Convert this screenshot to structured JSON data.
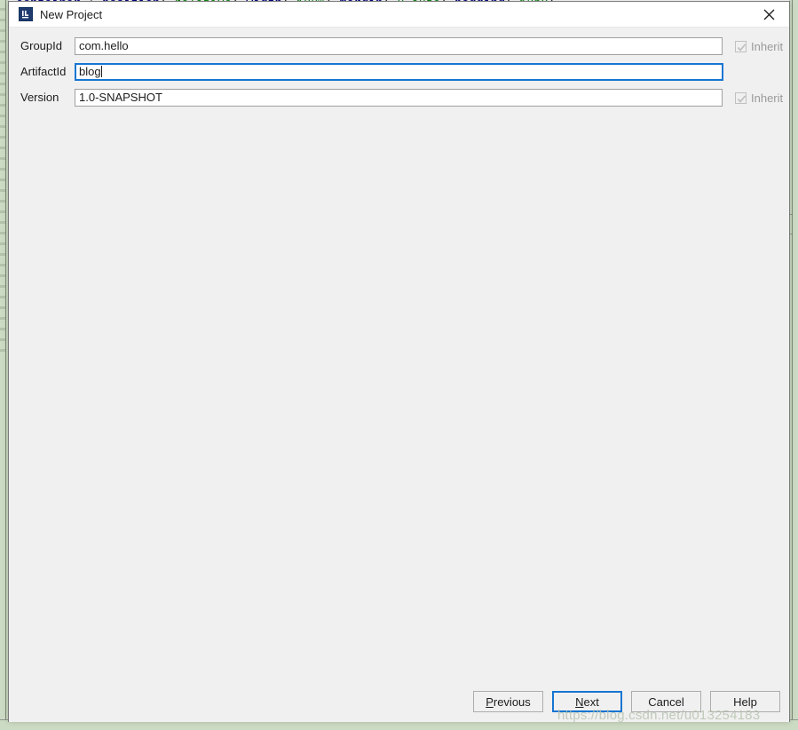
{
  "dialog": {
    "title": "New Project",
    "icon": "intellij-idea-icon",
    "close_icon": "close-icon"
  },
  "form": {
    "fields": [
      {
        "label": "GroupId",
        "value": "com.hello",
        "focused": false,
        "inherit_label": "Inherit",
        "inherit_checked": true,
        "inherit_disabled": true
      },
      {
        "label": "ArtifactId",
        "value": "blog",
        "focused": true,
        "inherit_label": null,
        "inherit_checked": false,
        "inherit_disabled": false
      },
      {
        "label": "Version",
        "value": "1.0-SNAPSHOT",
        "focused": false,
        "inherit_label": "Inherit",
        "inherit_checked": true,
        "inherit_disabled": true
      }
    ]
  },
  "buttons": {
    "previous": {
      "label_before": "",
      "mnemonic": "P",
      "label_after": "revious"
    },
    "next": {
      "label_before": "",
      "mnemonic": "N",
      "label_after": "ext",
      "is_default": true
    },
    "cancel": {
      "label": "Cancel"
    },
    "help": {
      "label": "Help"
    }
  },
  "background": {
    "watermark": "https://blog.csdn.net/u013254183",
    "code_line": {
      "property": "display",
      "colon": ": ",
      "value": "flex",
      "semicolon": ";"
    },
    "colors": {
      "accent": "#1675d1",
      "dialog_bg": "#f0f0f0",
      "titlebar_bg": "#ffffff",
      "ide_strip": "#ccdbc4",
      "disabled_text": "#9a9a9a"
    }
  }
}
